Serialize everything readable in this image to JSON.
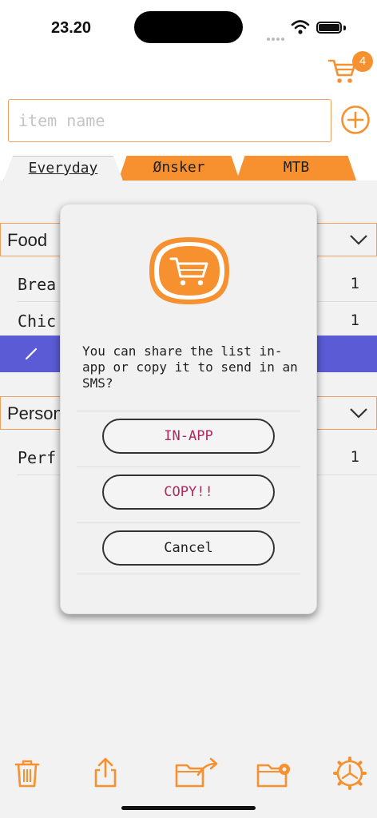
{
  "status_bar": {
    "time": "23.20"
  },
  "header": {
    "cart_badge": "4"
  },
  "input": {
    "placeholder": "item name",
    "value": ""
  },
  "tabs": [
    {
      "label": "Everyday",
      "active": true
    },
    {
      "label": "Ønsker",
      "active": false
    },
    {
      "label": "MTB",
      "active": false
    }
  ],
  "sections": [
    {
      "title": "Food",
      "rows": [
        {
          "name": "Brea",
          "qty": "1"
        },
        {
          "name": "Chic",
          "qty": "1"
        }
      ]
    },
    {
      "title": "Person",
      "rows": [
        {
          "name": "Perf",
          "qty": "1"
        }
      ]
    }
  ],
  "dialog": {
    "message": "You can share the list in-app or copy it to send in an SMS?",
    "buttons": {
      "in_app": "IN-APP",
      "copy": "COPY!!",
      "cancel": "Cancel"
    }
  },
  "toolbar": {
    "icons": [
      "trash-icon",
      "share-icon",
      "folder-export-icon",
      "folder-settings-icon",
      "settings-gear-icon"
    ]
  },
  "colors": {
    "accent": "#f7902f",
    "swipe_action": "#5b5bd6",
    "dialog_button_text": "#b0285c"
  }
}
